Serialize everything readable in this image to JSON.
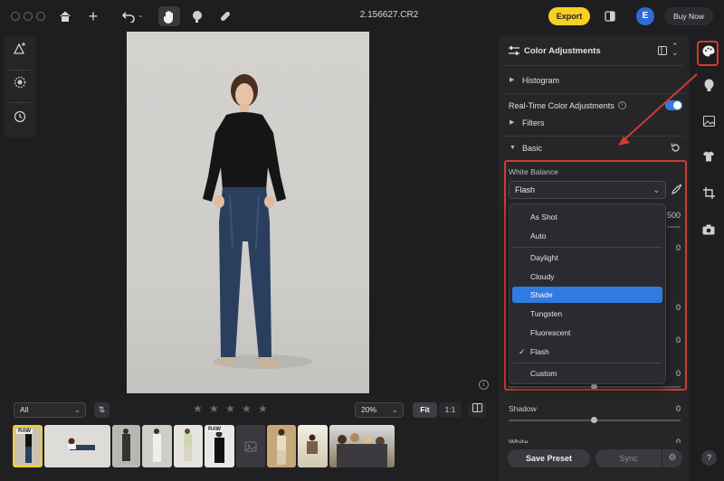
{
  "window": {
    "title": "2.156627.CR2"
  },
  "toolbar": {
    "home_icon": "home-icon",
    "add_icon": "plus-icon",
    "undo_icon": "undo-icon",
    "hand_icon": "hand-icon",
    "portrait_icon": "portrait-icon",
    "bandage_icon": "bandage-icon",
    "export_label": "Export",
    "compare_icon": "compare-icon",
    "avatar_letter": "E",
    "buy_now_label": "Buy Now"
  },
  "right_panel": {
    "title": "Color Adjustments",
    "histogram": "Histogram",
    "realtime": "Real-Time Color Adjustments",
    "realtime_on": true,
    "filters": "Filters",
    "basic": "Basic",
    "white_balance_label": "White Balance",
    "white_balance_value": "Flash",
    "hidden_value_500": "500",
    "hidden_zero": "0",
    "shadow_label": "Shadow",
    "shadow_value": "0",
    "white_label": "White",
    "white_value": "0",
    "save_preset": "Save Preset",
    "sync": "Sync"
  },
  "wb_menu": {
    "group1": [
      "As Shot",
      "Auto"
    ],
    "group2": [
      "Daylight",
      "Cloudy",
      "Shade",
      "Tungsten",
      "Fluorescent",
      "Flash"
    ],
    "group3": [
      "Custom"
    ],
    "highlighted": "Shade",
    "checked": "Flash"
  },
  "filmstrip": {
    "filter_value": "All",
    "zoom_value": "20%",
    "fit_label": "Fit",
    "one_to_one_label": "1:1",
    "rating_stars": 5,
    "raw_badge": "RAW",
    "stack_count": "2"
  },
  "colors": {
    "accent": "#2f7be0",
    "export": "#f5d020",
    "highlight_box": "#d23a2e"
  }
}
